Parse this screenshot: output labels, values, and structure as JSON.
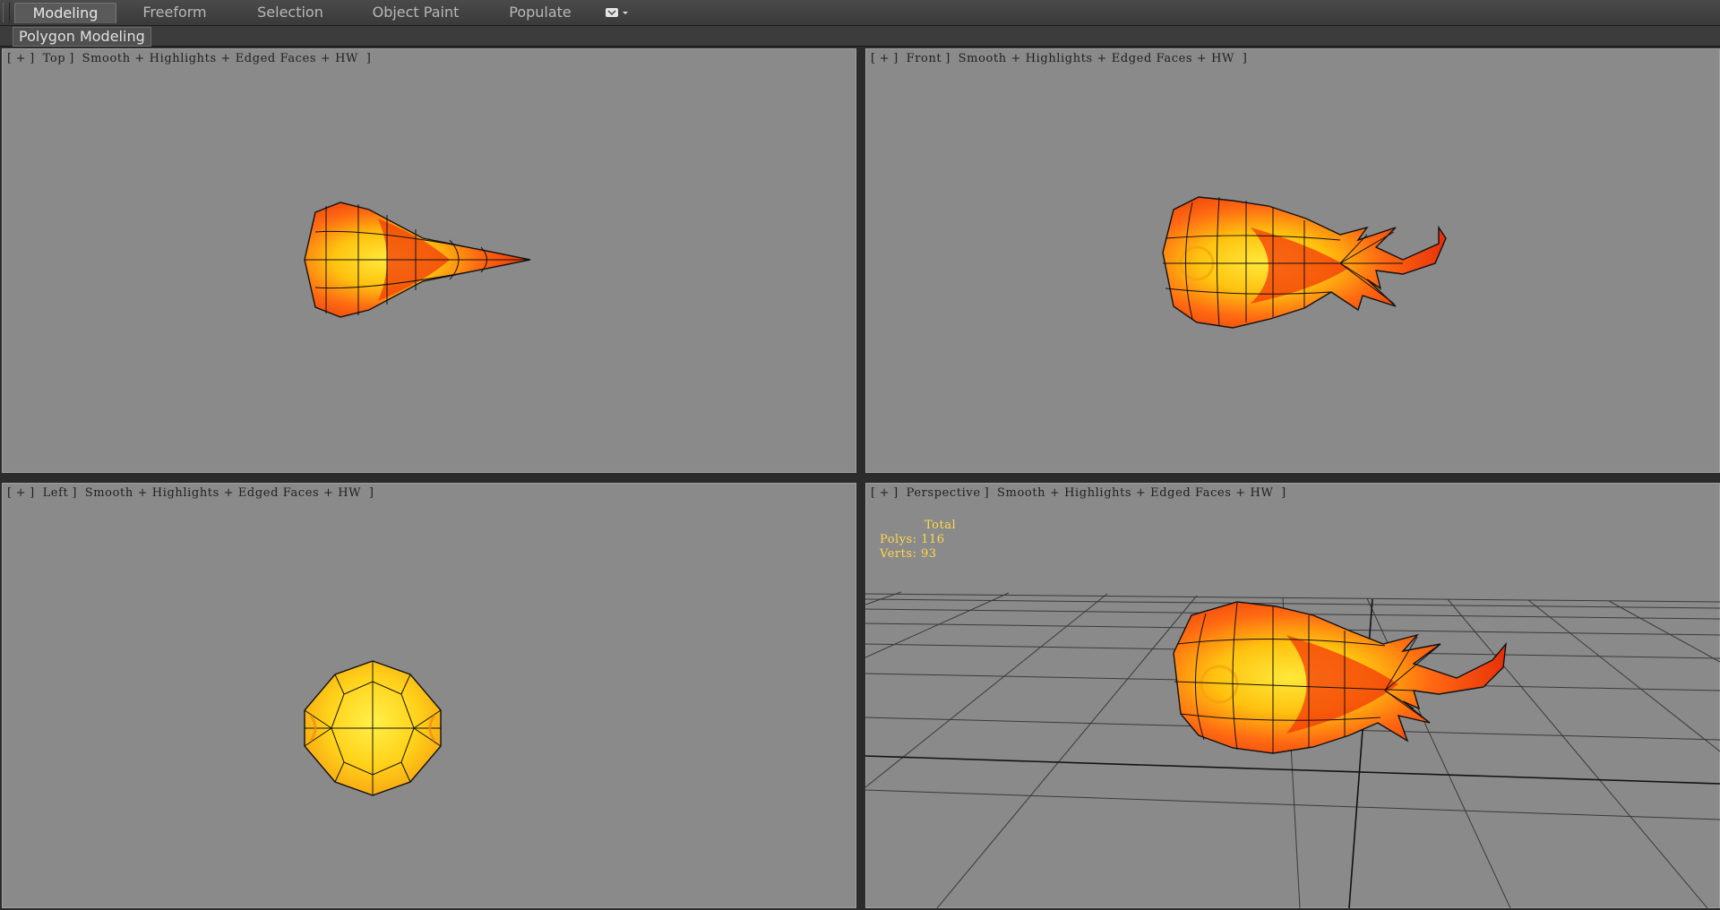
{
  "ribbon": {
    "tabs": [
      {
        "label": "Modeling",
        "active": true
      },
      {
        "label": "Freeform",
        "active": false
      },
      {
        "label": "Selection",
        "active": false
      },
      {
        "label": "Object Paint",
        "active": false
      },
      {
        "label": "Populate",
        "active": false
      }
    ],
    "menu_icon": "dropdown-menu-icon",
    "panel_label": "Polygon Modeling"
  },
  "viewports": {
    "top": {
      "plus": "+",
      "name": "Top",
      "shading": "Smooth + Highlights + Edged Faces + HW"
    },
    "front": {
      "plus": "+",
      "name": "Front",
      "shading": "Smooth + Highlights + Edged Faces + HW"
    },
    "left": {
      "plus": "+",
      "name": "Left",
      "shading": "Smooth + Highlights + Edged Faces + HW"
    },
    "perspective": {
      "plus": "+",
      "name": "Perspective",
      "shading": "Smooth + Highlights + Edged Faces + HW"
    }
  },
  "stats": {
    "header": "Total",
    "polys_label": "Polys:",
    "polys_value": "116",
    "verts_label": "Verts:",
    "verts_value": "93"
  },
  "colors": {
    "viewport_bg": "#8a8a8a",
    "stats_text": "#ffd84a",
    "fire_yellow": "#ffd21a",
    "fire_orange": "#ff7a10",
    "fire_red": "#f02a0a"
  }
}
